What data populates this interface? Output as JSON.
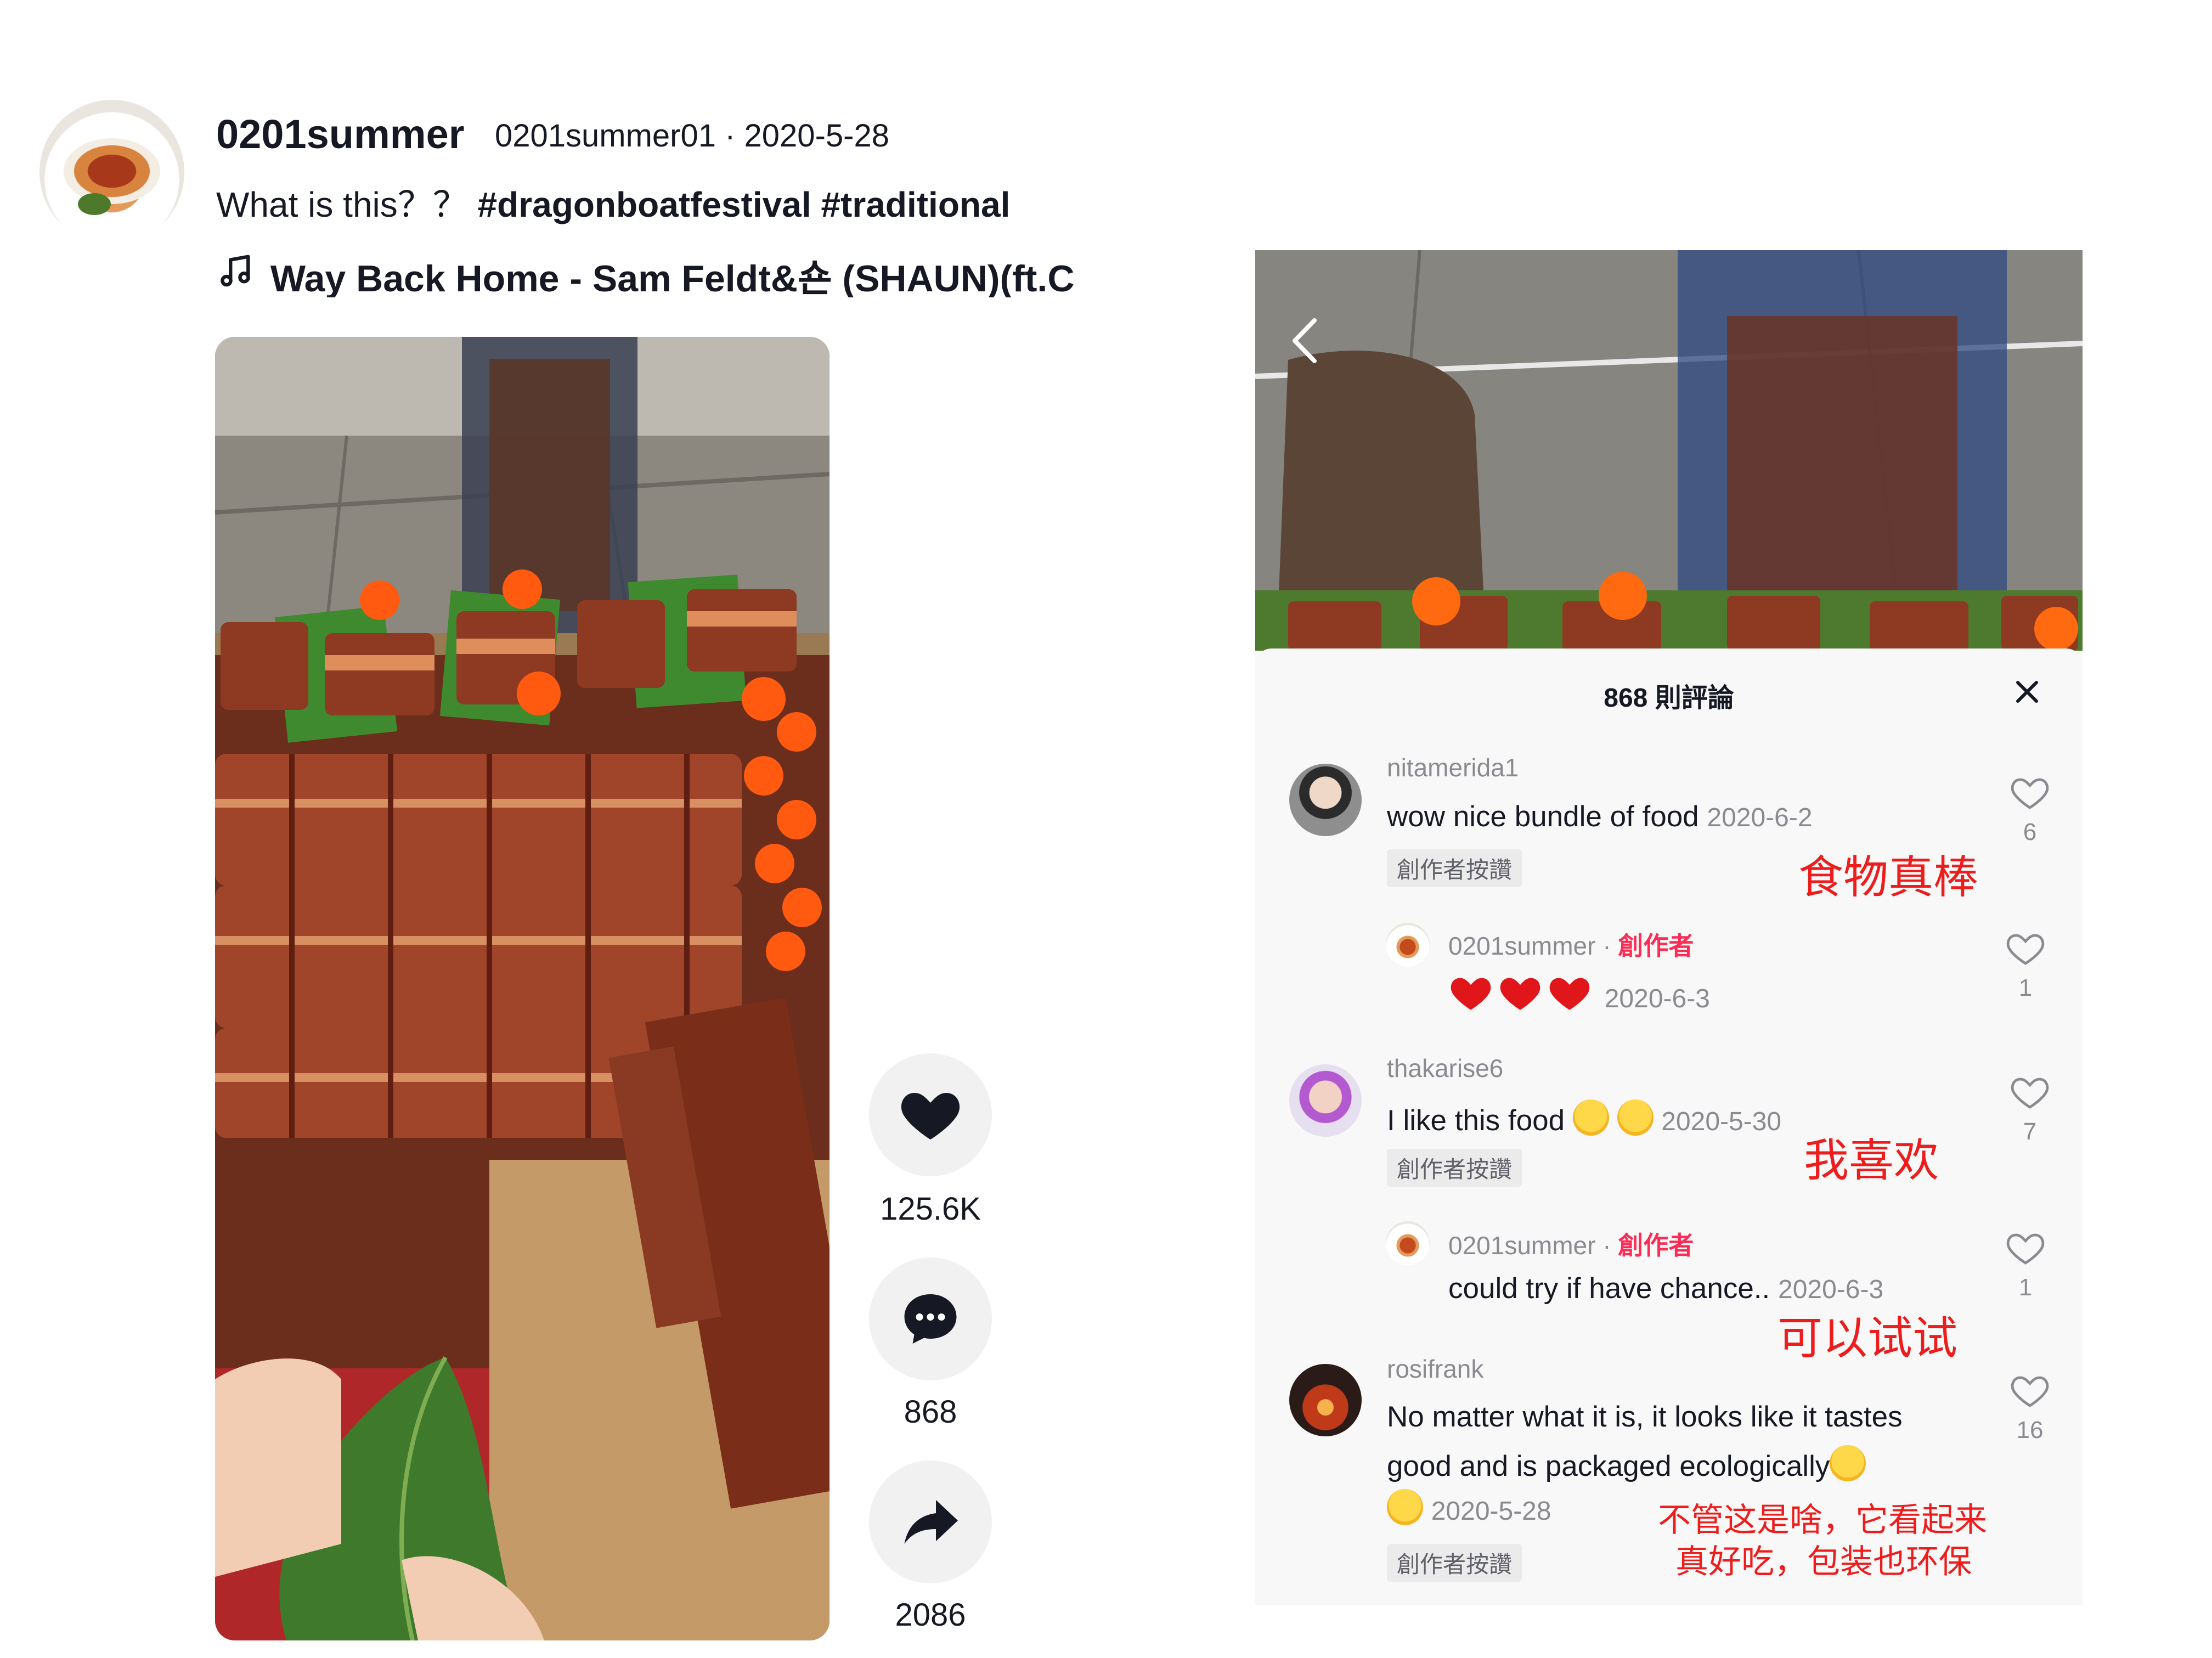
{
  "post": {
    "username": "0201summer",
    "handle_date": "0201summer01 · 2020-5-28",
    "caption_text": "What is this？？",
    "caption_tags": "#dragonboatfestival #traditional",
    "music": "Way Back Home - Sam Feldt&숀 (SHAUN)(ft.C"
  },
  "actions": {
    "likes": "125.6K",
    "comments": "868",
    "shares": "2086"
  },
  "comments_panel": {
    "title": "868 則評論",
    "creator_label": "創作者",
    "creator_liked_badge": "創作者按讚",
    "comments": [
      {
        "user": "nitamerida1",
        "text": "wow nice bundle of food",
        "date": "2020-6-2",
        "likes": "6",
        "annotation": "食物真棒",
        "reply": {
          "user": "0201summer",
          "date": "2020-6-3",
          "likes": "1"
        }
      },
      {
        "user": "thakarise6",
        "text": "I like this food",
        "date": "2020-5-30",
        "likes": "7",
        "annotation": "我喜欢",
        "reply": {
          "user": "0201summer",
          "text": "could try if have chance..",
          "date": "2020-6-3",
          "likes": "1",
          "annotation": "可以试试"
        }
      },
      {
        "user": "rosifrank",
        "text_line1": "No matter what it is, it looks like it tastes",
        "text_line2": "good and is packaged ecologically",
        "date": "2020-5-28",
        "likes": "16",
        "annotation_line1": "不管这是啥，它看起来",
        "annotation_line2": "真好吃，包装也环保"
      }
    ]
  },
  "colors": {
    "text": "#161823",
    "secondary": "#8a8b91",
    "creator": "#fe2c55",
    "annotation": "#ee1d1d",
    "button_bg": "#f1f1f2"
  }
}
